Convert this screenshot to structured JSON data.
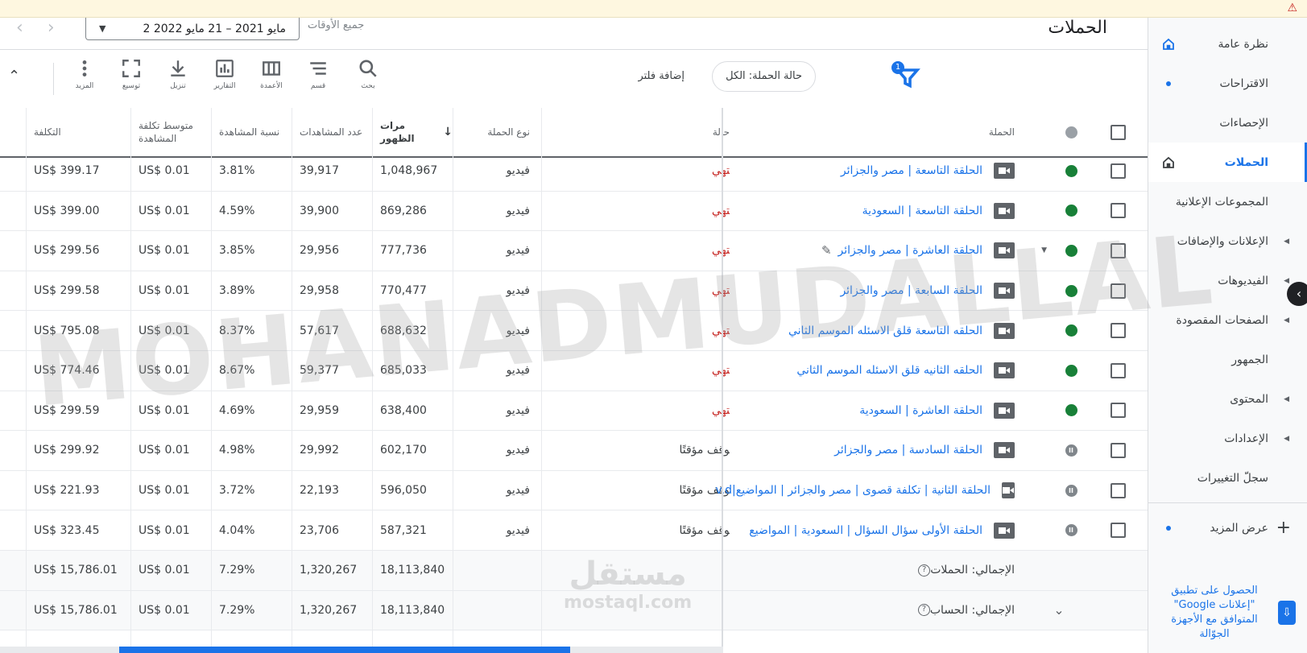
{
  "page": {
    "title": "الحملات",
    "date_label": "جميع الأوقات",
    "date_range": "2 مايو 2021 – 21 مايو 2022",
    "fab": "+"
  },
  "sidebar": {
    "items": [
      {
        "label": "نظرة عامة",
        "icon": "home-icon"
      },
      {
        "label": "الاقتراحات",
        "icon": "dot"
      },
      {
        "label": "الإحصاءات"
      },
      {
        "label": "الحملات",
        "icon": "home-icon",
        "active": true
      },
      {
        "label": "المجموعات الإعلانية"
      },
      {
        "label": "الإعلانات والإضافات",
        "expandable": true
      },
      {
        "label": "الفيديوهات",
        "expandable": true
      },
      {
        "label": "الصفحات المقصودة",
        "expandable": true
      },
      {
        "label": "الجمهور"
      },
      {
        "label": "المحتوى",
        "expandable": true
      },
      {
        "label": "الإعدادات",
        "expandable": true
      },
      {
        "label": "سجلّ التغييرات"
      },
      {
        "label": "عرض المزيد",
        "icon": "plus"
      }
    ],
    "app_promo": "الحصول على تطبيق \"إعلانات Google\" المتوافق مع الأجهزة الجوّالة"
  },
  "toolbar": {
    "search": "بحث",
    "segment": "قسم",
    "columns": "الأعمدة",
    "reports": "التقارير",
    "download": "تنزيل",
    "expand": "توسيع",
    "more": "المزيد",
    "add_filter": "إضافة فلتر",
    "filter_chip": "حالة الحملة: الكل",
    "filter_count": "1"
  },
  "table": {
    "headers": {
      "campaign": "الحملة",
      "status": "حالة",
      "type": "نوع الحملة",
      "impressions": "مرات الظهور",
      "views": "عدد المشاهدات",
      "view_rate": "نسبة المشاهدة",
      "avg_cpv": "متوسط تكلفة المشاهدة",
      "cost": "التكلفة"
    },
    "rows": [
      {
        "name": "الحلقة التاسعة | مصر والجزائر",
        "status": "منتهي",
        "state": "ended",
        "type": "فيديو",
        "impressions": "1,048,967",
        "views": "39,917",
        "rate": "3.81%",
        "avg": "US$ 0.01",
        "cost": "US$ 399.17"
      },
      {
        "name": "الحلقة التاسعة | السعودية",
        "status": "منتهي",
        "state": "ended",
        "type": "فيديو",
        "impressions": "869,286",
        "views": "39,900",
        "rate": "4.59%",
        "avg": "US$ 0.01",
        "cost": "US$ 399.00"
      },
      {
        "name": "الحلقة العاشرة | مصر والجزائر",
        "status": "منتهي",
        "state": "ended",
        "type": "فيديو",
        "impressions": "777,736",
        "views": "29,956",
        "rate": "3.85%",
        "avg": "US$ 0.01",
        "cost": "US$ 299.56",
        "editing": true
      },
      {
        "name": "الحلقة السابعة | مصر والجزائر",
        "status": "منتهي",
        "state": "ended",
        "type": "فيديو",
        "impressions": "770,477",
        "views": "29,958",
        "rate": "3.89%",
        "avg": "US$ 0.01",
        "cost": "US$ 299.58"
      },
      {
        "name": "الحلقه التاسعة قلق الاسئله الموسم الثاني",
        "status": "منتهي",
        "state": "ended",
        "type": "فيديو",
        "impressions": "688,632",
        "views": "57,617",
        "rate": "8.37%",
        "avg": "US$ 0.01",
        "cost": "US$ 795.08"
      },
      {
        "name": "الحلقه الثانيه قلق الاسئله الموسم الثاني",
        "status": "منتهي",
        "state": "ended",
        "type": "فيديو",
        "impressions": "685,033",
        "views": "59,377",
        "rate": "8.67%",
        "avg": "US$ 0.01",
        "cost": "US$ 774.46"
      },
      {
        "name": "الحلقة العاشرة | السعودية",
        "status": "منتهي",
        "state": "ended",
        "type": "فيديو",
        "impressions": "638,400",
        "views": "29,959",
        "rate": "4.69%",
        "avg": "US$ 0.01",
        "cost": "US$ 299.59"
      },
      {
        "name": "الحلقة السادسة | مصر والجزائر",
        "status": "متوقف مؤقتًا",
        "state": "paused",
        "type": "فيديو",
        "impressions": "602,170",
        "views": "29,992",
        "rate": "4.98%",
        "avg": "US$ 0.01",
        "cost": "US$ 299.92"
      },
      {
        "name": "الحلقة الثانية | تكلفة قصوى | مصر والجزائر | المواضيع|v.d",
        "status": "متوقف مؤقتًا",
        "state": "paused",
        "type": "فيديو",
        "impressions": "596,050",
        "views": "22,193",
        "rate": "3.72%",
        "avg": "US$ 0.01",
        "cost": "US$ 221.93"
      },
      {
        "name": "الحلقة الأولى سؤال السؤال | السعودية | المواضيع",
        "status": "متوقف مؤقتًا",
        "state": "paused",
        "type": "فيديو",
        "impressions": "587,321",
        "views": "23,706",
        "rate": "4.04%",
        "avg": "US$ 0.01",
        "cost": "US$ 323.45"
      }
    ],
    "totals": [
      {
        "label": "الإجمالي: الحملات",
        "impressions": "18,113,840",
        "views": "1,320,267",
        "rate": "7.29%",
        "avg": "US$ 0.01",
        "cost": "US$ 15,786.01"
      },
      {
        "label": "الإجمالي: الحساب",
        "impressions": "18,113,840",
        "views": "1,320,267",
        "rate": "7.29%",
        "avg": "US$ 0.01",
        "cost": "US$ 15,786.01"
      }
    ]
  },
  "watermark": {
    "text": "MOHANADMUDALLAL",
    "site_ar": "مستقل",
    "site_en": "mostaql.com"
  },
  "colors": {
    "accent": "#1a73e8",
    "active_green": "#188038",
    "ended_red": "#c5221f"
  }
}
